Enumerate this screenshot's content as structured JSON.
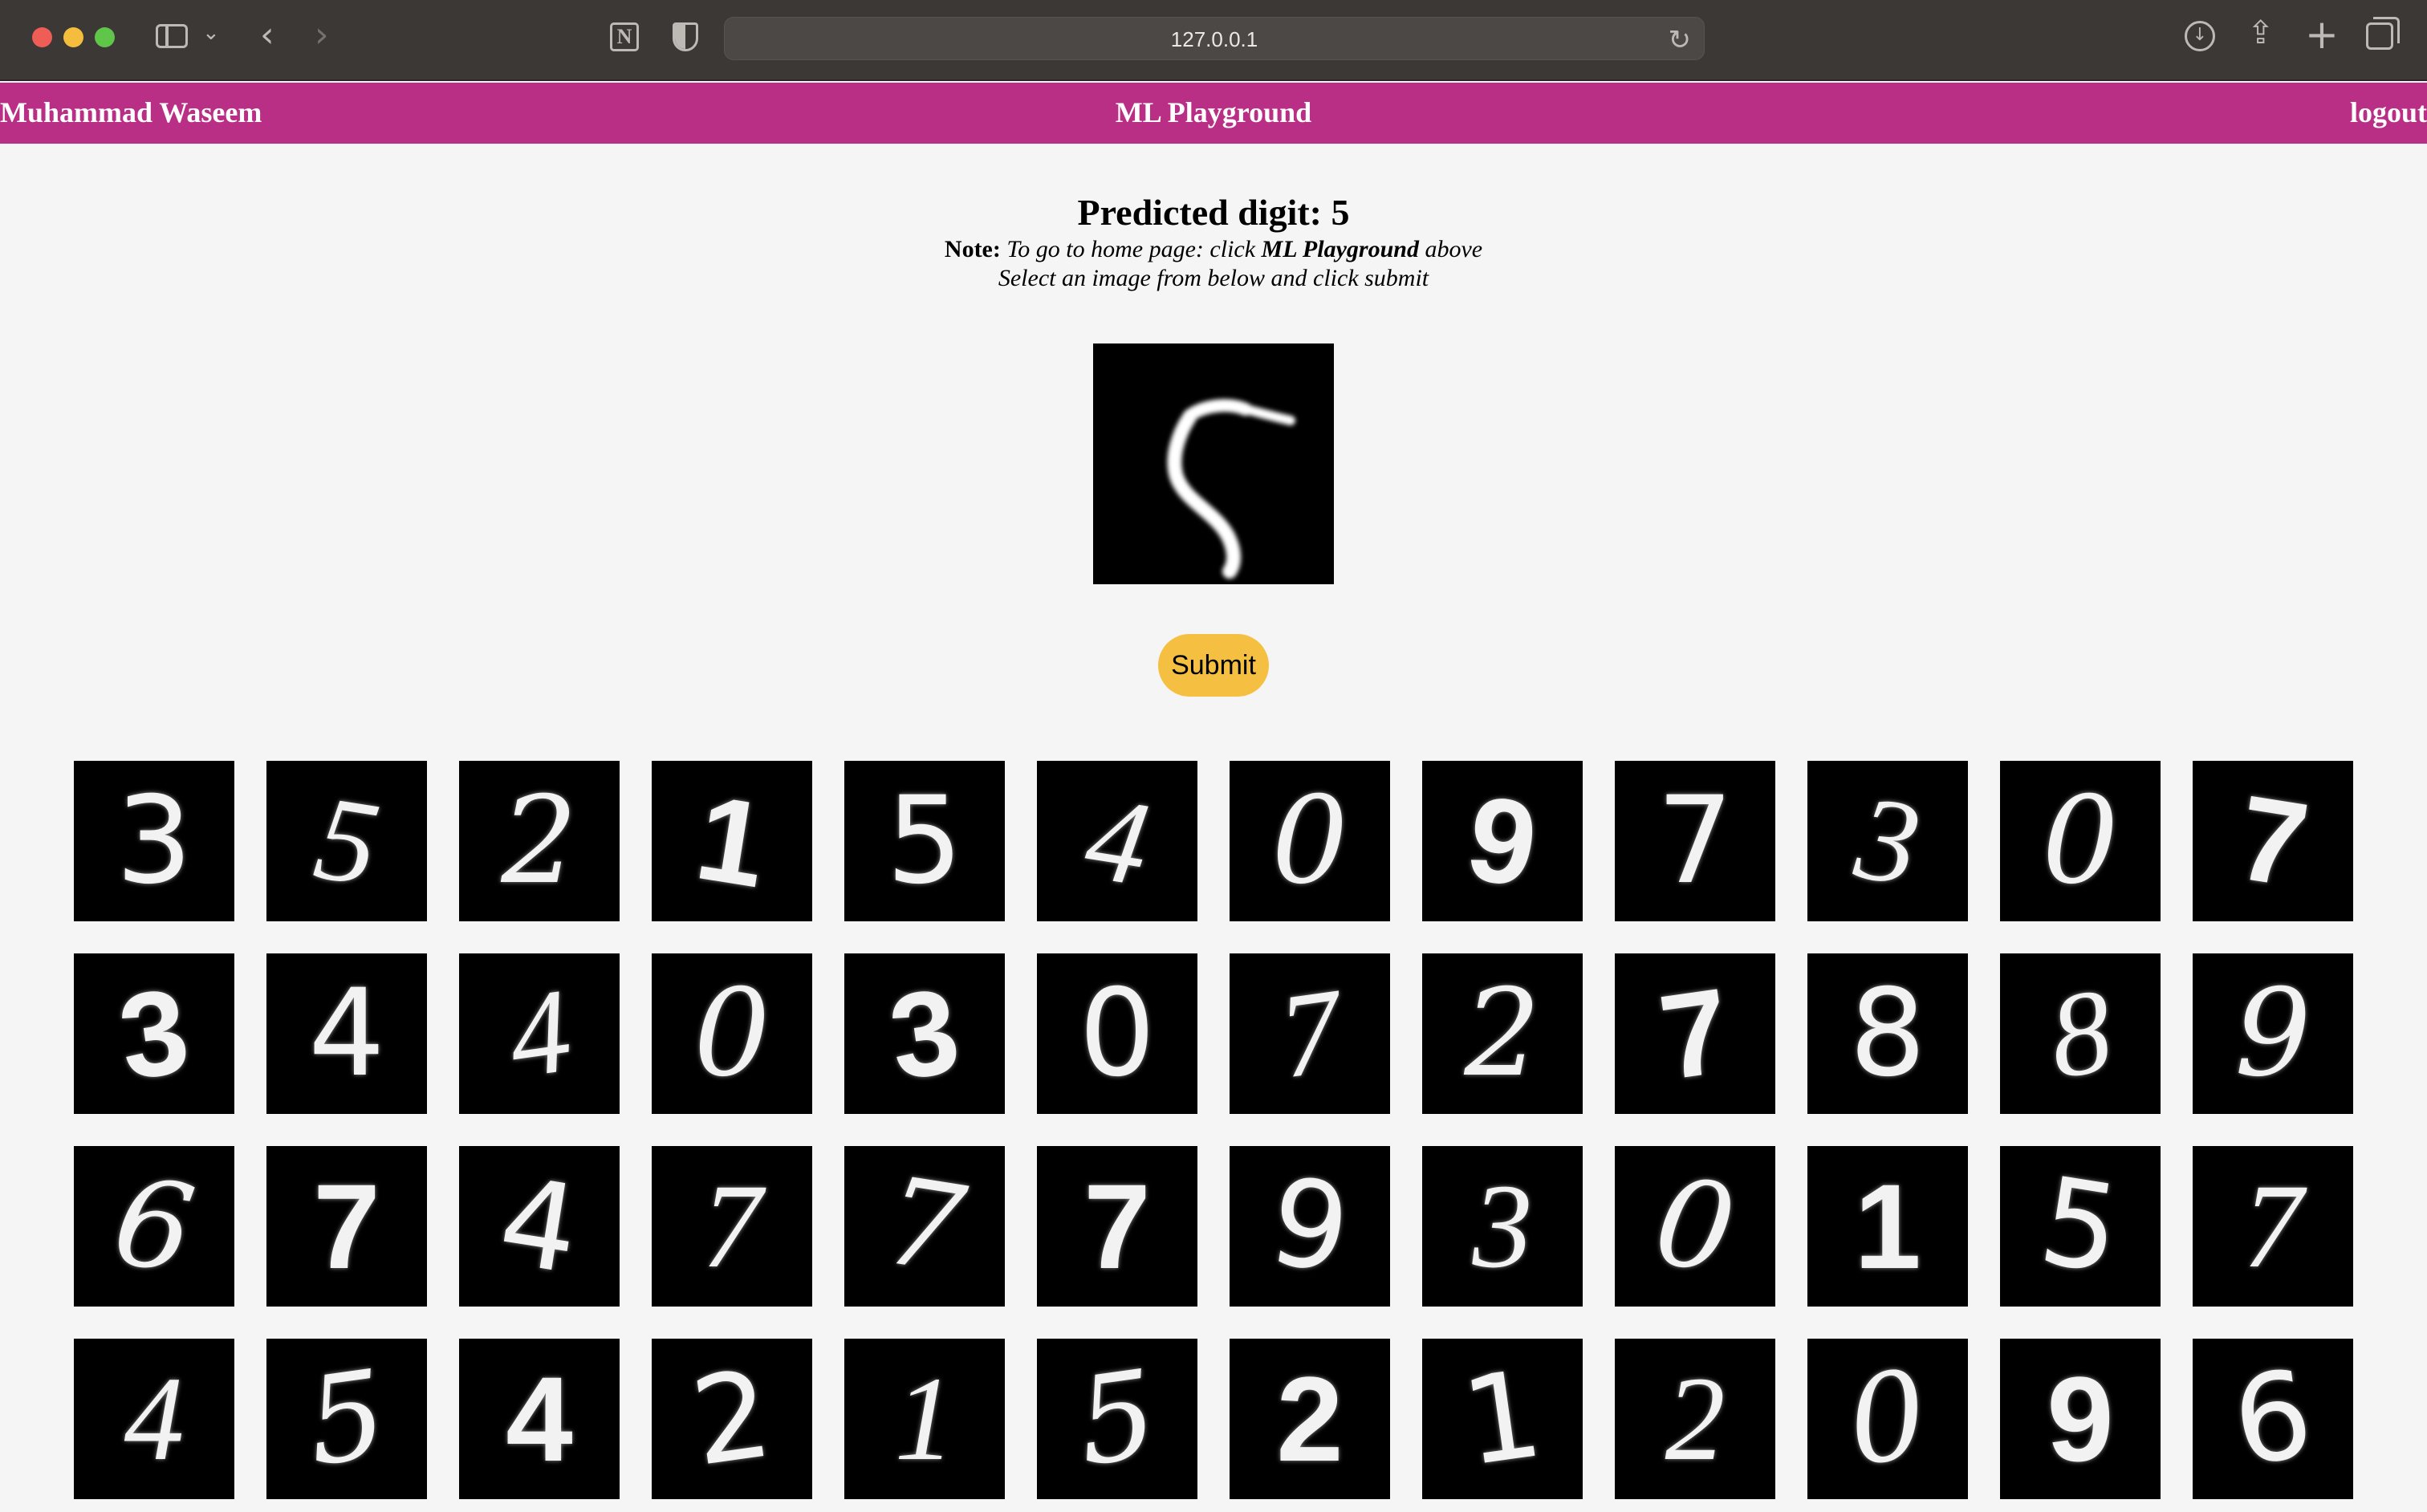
{
  "browser": {
    "url": "127.0.0.1",
    "icons": {
      "sidebar": "sidebar-toggle-icon",
      "back": "back-arrow-icon",
      "forward": "forward-arrow-icon",
      "notion": "notion-extension-icon",
      "shield": "privacy-shield-icon",
      "reload": "reload-icon",
      "download": "download-icon",
      "share": "share-icon",
      "new_tab": "plus-icon",
      "tabs": "tab-overview-icon"
    }
  },
  "navbar": {
    "user": "Muhammad Waseem",
    "title": "ML Playground",
    "logout": "logout",
    "color": "#b92f86"
  },
  "main": {
    "headline": "Predicted digit: 5",
    "note_label": "Note:",
    "note_pre": " To go to home page: click ",
    "note_link": "ML Playground",
    "note_post": " above",
    "instruction": "Select an image from below and click submit",
    "selected_digit": "5",
    "submit_label": "Submit",
    "submit_color": "#f5c042"
  },
  "digit_grid": {
    "rows": [
      [
        "3",
        "5",
        "2",
        "1",
        "5",
        "4",
        "0",
        "9",
        "7",
        "3",
        "0",
        "7"
      ],
      [
        "3",
        "4",
        "4",
        "0",
        "3",
        "0",
        "7",
        "2",
        "7",
        "8",
        "8",
        "9"
      ],
      [
        "6",
        "7",
        "4",
        "7",
        "7",
        "7",
        "9",
        "3",
        "0",
        "1",
        "5",
        "7"
      ],
      [
        "4",
        "5",
        "4",
        "2",
        "1",
        "5",
        "2",
        "1",
        "2",
        "0",
        "9",
        "6"
      ]
    ]
  }
}
